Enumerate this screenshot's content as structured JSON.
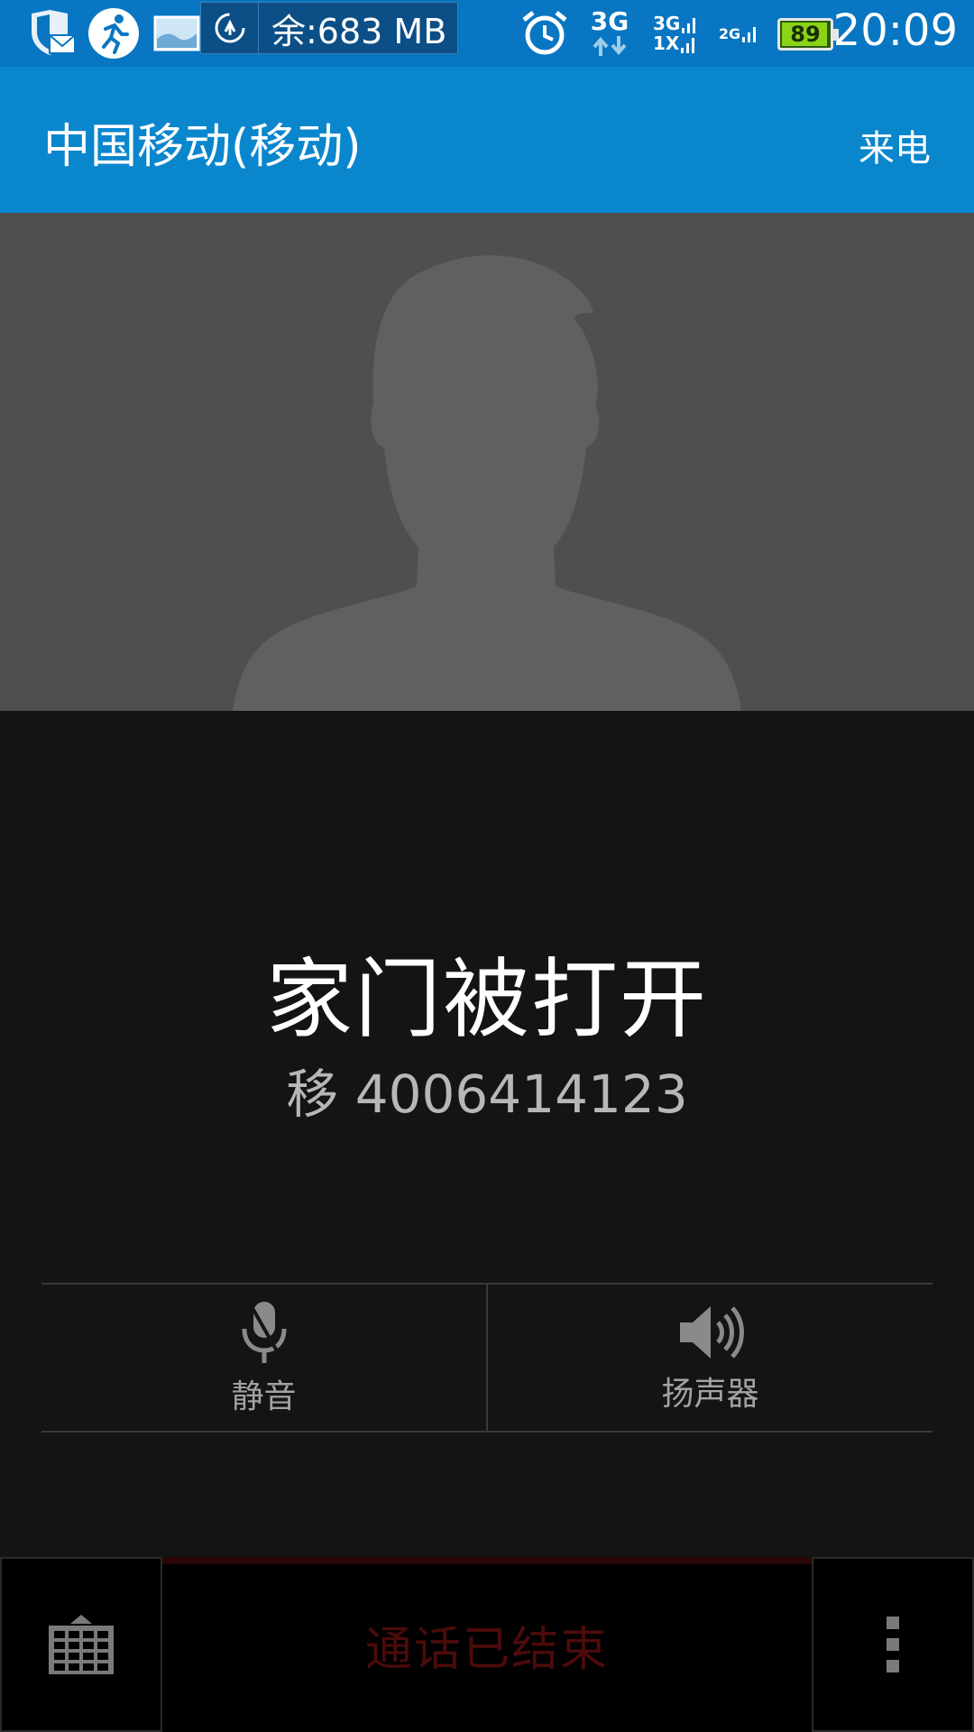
{
  "status_bar": {
    "memory_text": "余:683 MB",
    "network_3g": "3G",
    "sim1_label": "3G",
    "sim1_sub": "1X",
    "sim2_label": "2G",
    "battery_level": "89",
    "time": "20:09",
    "icons": [
      "shield-mail-icon",
      "running-man-icon",
      "image-notification-icon",
      "memory-gauge-icon",
      "alarm-clock-icon",
      "data-arrows-icon",
      "signal-bars-icon",
      "battery-icon"
    ]
  },
  "app_bar": {
    "carrier": "中国移动(移动)",
    "call_type": "来电"
  },
  "caller": {
    "name": "家门被打开",
    "number": "移 4006414123"
  },
  "controls": [
    {
      "label": "静音",
      "icon": "microphone-mute-icon"
    },
    {
      "label": "扬声器",
      "icon": "speaker-icon"
    }
  ],
  "bottom_bar": {
    "end_label": "通话已结束",
    "left_icon": "dialpad-icon",
    "right_icon": "overflow-menu-icon"
  },
  "colors": {
    "status_bar_bg": "#0876c2",
    "app_bar_bg": "#0a86cd",
    "photo_bg": "#4f4f4f",
    "body_bg": "#141414",
    "end_call_text": "#4c0b0b"
  }
}
